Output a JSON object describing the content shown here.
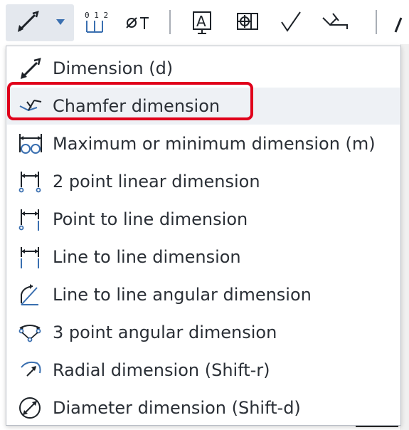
{
  "toolbar": {
    "buttons": [
      {
        "name": "dimension-tool-button",
        "icon": "dimension-icon"
      },
      {
        "name": "dimension-dropdown-caret",
        "icon": "caret-down-icon"
      },
      {
        "name": "ordinate-dimension-button",
        "icon": "ordinate-icon",
        "glyph": "0 1 2"
      },
      {
        "name": "diameter-symbol-button",
        "icon": "diameter-symbol-icon",
        "glyph": "⌀⊤"
      },
      {
        "name": "note-button",
        "icon": "note-a-icon",
        "glyph": "A"
      },
      {
        "name": "datum-button",
        "icon": "datum-icon"
      },
      {
        "name": "surface-finish-button",
        "icon": "checkmark-icon",
        "glyph": "√"
      },
      {
        "name": "weld-symbol-button",
        "icon": "weld-symbol-icon"
      }
    ],
    "active_color": "#e4e8ee"
  },
  "menu": {
    "items": [
      {
        "label": "Dimension (d)",
        "icon": "dimension-icon"
      },
      {
        "label": "Chamfer dimension",
        "icon": "chamfer-dimension-icon"
      },
      {
        "label": "Maximum or minimum dimension (m)",
        "icon": "max-min-dimension-icon"
      },
      {
        "label": "2 point linear dimension",
        "icon": "two-point-linear-icon"
      },
      {
        "label": "Point to line dimension",
        "icon": "point-to-line-icon"
      },
      {
        "label": "Line to line dimension",
        "icon": "line-to-line-icon"
      },
      {
        "label": "Line to line angular dimension",
        "icon": "angular-dimension-icon"
      },
      {
        "label": "3 point angular dimension",
        "icon": "three-point-angular-icon"
      },
      {
        "label": "Radial dimension (Shift-r)",
        "icon": "radial-dimension-icon"
      },
      {
        "label": "Diameter dimension (Shift-d)",
        "icon": "diameter-dimension-icon"
      }
    ],
    "hovered_item": "Chamfer dimension",
    "highlight_color": "#e0001b",
    "icon_color": "#3a6fb0"
  }
}
